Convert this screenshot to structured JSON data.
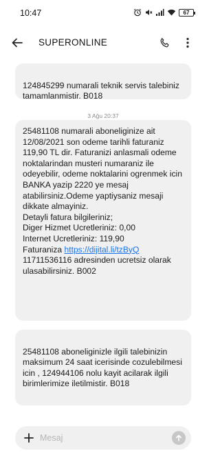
{
  "status_bar": {
    "time": "10:47",
    "battery": "67",
    "icons": [
      "alarm-icon",
      "mute-icon",
      "signal-icon",
      "wifi-icon",
      "battery-icon"
    ]
  },
  "header": {
    "contact_name": "SUPERONLINE",
    "icons": [
      "back-arrow-icon",
      "phone-icon",
      "more-vert-icon"
    ]
  },
  "messages": [
    {
      "text": "124845299 numarali teknik servis talebiniz tamamlanmistir. B018"
    },
    {
      "date": "3 Ağu 20:37",
      "text_before_link": "25481108 numarali aboneliginize ait 12/08/2021 son odeme tarihli faturaniz 119,90 TL dir. Faturanizi anlasmali odeme noktalarindan musteri numaraniz ile odeyebilir, odeme noktalarini ogrenmek icin BANKA yazip 2220 ye mesaj atabilirsiniz.Odeme yaptiysaniz mesaji dikkate almayiniz.\nDetayli fatura bilgileriniz;\nDiger Hizmet Ucretleriniz: 0,00\nInternet Ucretleriniz: 119,90\nFaturaniza ",
      "link": "https://dijital.li/tzByQ",
      "text_after_link": "\n11711536116 adresinden ucretsiz olarak ulasabilirsiniz. B002"
    },
    {
      "text": "25481108 aboneliginizle ilgili talebinizin maksimum 24 saat icerisinde cozulebilmesi icin , 124944106 nolu kayit acilarak ilgili birimlerimize iletilmistir. B018"
    }
  ],
  "compose": {
    "placeholder": "Mesaj",
    "value": ""
  },
  "colors": {
    "bubble": "#f0f0f0",
    "link": "#1a73e8",
    "send_disabled": "#c7c7c7"
  }
}
